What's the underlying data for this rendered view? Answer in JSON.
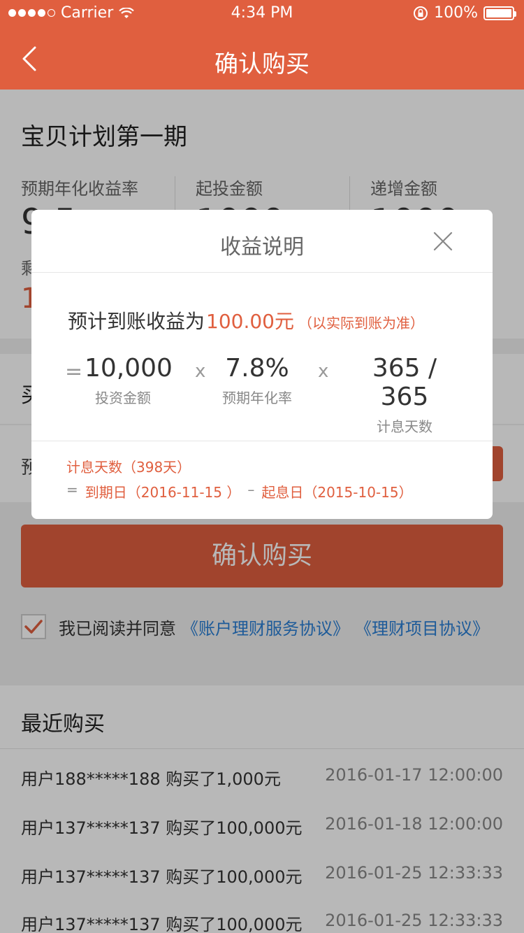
{
  "status": {
    "carrier": "Carrier",
    "time": "4:34 PM",
    "battery": "100%"
  },
  "nav": {
    "title": "确认购买"
  },
  "product": {
    "name": "宝贝计划第一期",
    "stats": [
      {
        "label": "预期年化收益率",
        "value": "9.5"
      },
      {
        "label": "起投金额",
        "value": "1000"
      },
      {
        "label": "递增金额",
        "value": "1000"
      }
    ],
    "remain_label": "剩",
    "remain_value": "1"
  },
  "buy": {
    "label": "买"
  },
  "estimate": {
    "label": "预"
  },
  "confirm_button": "确认购买",
  "agreement": {
    "text": "我已阅读并同意",
    "link1": "《账户理财服务协议》",
    "link2": "《理财项目协议》"
  },
  "recent": {
    "title": "最近购买",
    "items": [
      {
        "who": "用户188*****188 购买了1,000元",
        "when": "2016-01-17 12:00:00"
      },
      {
        "who": "用户137*****137 购买了100,000元",
        "when": "2016-01-18 12:00:00"
      },
      {
        "who": "用户137*****137 购买了100,000元",
        "when": "2016-01-25 12:33:33"
      },
      {
        "who": "用户137*****137 购买了100,000元",
        "when": "2016-01-25 12:33:33"
      }
    ]
  },
  "modal": {
    "title": "收益说明",
    "summary_prefix": "预计到账收益为",
    "summary_amount": "100.00元",
    "summary_note": "（以实际到账为准）",
    "formula": {
      "eq": "=",
      "amount": "10,000",
      "amount_label": "投资金额",
      "x1": "x",
      "rate": "7.8%",
      "rate_label": "预期年化率",
      "x2": "x",
      "days": "365 / 365",
      "days_label": "计息天数"
    },
    "days_line": "计息天数（398天）",
    "line2_eq": "=",
    "due": "到期日（2016-11-15 ）",
    "minus": "–",
    "start": "起息日（2015-10-15）"
  },
  "colors": {
    "brand": "#e05f3f",
    "link": "#2a7fd4"
  }
}
